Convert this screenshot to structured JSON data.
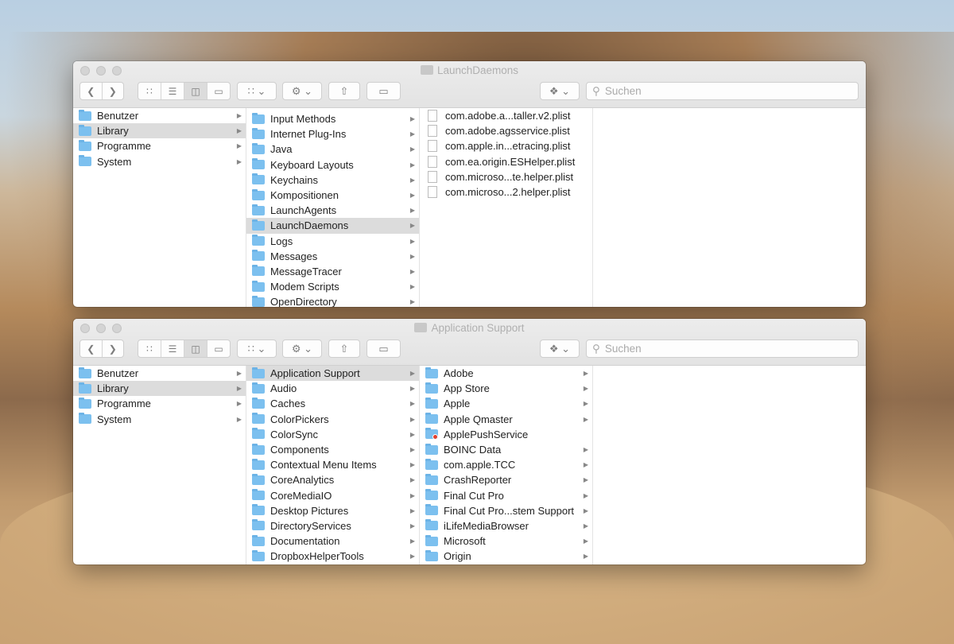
{
  "windows": [
    {
      "title": "LaunchDaemons",
      "search_placeholder": "Suchen",
      "sidebar": [
        {
          "label": "Benutzer"
        },
        {
          "label": "Library",
          "selected": true
        },
        {
          "label": "Programme"
        },
        {
          "label": "System"
        }
      ],
      "columns": [
        {
          "partial_top": true,
          "items": [
            {
              "label": "Input Methods"
            },
            {
              "label": "Internet Plug-Ins"
            },
            {
              "label": "Java"
            },
            {
              "label": "Keyboard Layouts"
            },
            {
              "label": "Keychains"
            },
            {
              "label": "Kompositionen"
            },
            {
              "label": "LaunchAgents"
            },
            {
              "label": "LaunchDaemons",
              "selected": true
            },
            {
              "label": "Logs"
            },
            {
              "label": "Messages"
            },
            {
              "label": "MessageTracer"
            },
            {
              "label": "Modem Scripts"
            },
            {
              "label": "OpenDirectory"
            }
          ]
        },
        {
          "files": true,
          "items": [
            {
              "label": "com.adobe.a...taller.v2.plist"
            },
            {
              "label": "com.adobe.agsservice.plist"
            },
            {
              "label": "com.apple.in...etracing.plist"
            },
            {
              "label": "com.ea.origin.ESHelper.plist"
            },
            {
              "label": "com.microso...te.helper.plist"
            },
            {
              "label": "com.microso...2.helper.plist"
            }
          ]
        }
      ]
    },
    {
      "title": "Application Support",
      "search_placeholder": "Suchen",
      "sidebar": [
        {
          "label": "Benutzer"
        },
        {
          "label": "Library",
          "selected": true
        },
        {
          "label": "Programme"
        },
        {
          "label": "System"
        }
      ],
      "columns": [
        {
          "items": [
            {
              "label": "Application Support",
              "selected": true
            },
            {
              "label": "Audio"
            },
            {
              "label": "Caches"
            },
            {
              "label": "ColorPickers"
            },
            {
              "label": "ColorSync"
            },
            {
              "label": "Components"
            },
            {
              "label": "Contextual Menu Items"
            },
            {
              "label": "CoreAnalytics"
            },
            {
              "label": "CoreMediaIO"
            },
            {
              "label": "Desktop Pictures"
            },
            {
              "label": "DirectoryServices"
            },
            {
              "label": "Documentation"
            },
            {
              "label": "DropboxHelperTools"
            }
          ]
        },
        {
          "items": [
            {
              "label": "Adobe"
            },
            {
              "label": "App Store"
            },
            {
              "label": "Apple"
            },
            {
              "label": "Apple Qmaster"
            },
            {
              "label": "ApplePushService",
              "restricted": true,
              "noarrow": true
            },
            {
              "label": "BOINC Data"
            },
            {
              "label": "com.apple.TCC"
            },
            {
              "label": "CrashReporter"
            },
            {
              "label": "Final Cut Pro"
            },
            {
              "label": "Final Cut Pro...stem Support"
            },
            {
              "label": "iLifeMediaBrowser"
            },
            {
              "label": "Microsoft"
            },
            {
              "label": "Origin"
            }
          ]
        }
      ]
    }
  ],
  "colors": {
    "folder": "#7cc0ef",
    "selection": "#dcdcdc"
  }
}
